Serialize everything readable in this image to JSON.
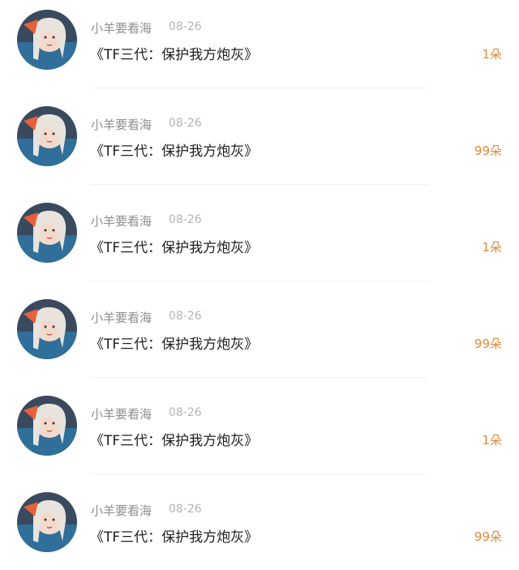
{
  "items": [
    {
      "user": "小羊要看海",
      "date": "08-26",
      "title": "《TF三代：保护我方炮灰》",
      "gift": "1朵"
    },
    {
      "user": "小羊要看海",
      "date": "08-26",
      "title": "《TF三代：保护我方炮灰》",
      "gift": "99朵"
    },
    {
      "user": "小羊要看海",
      "date": "08-26",
      "title": "《TF三代：保护我方炮灰》",
      "gift": "1朵"
    },
    {
      "user": "小羊要看海",
      "date": "08-26",
      "title": "《TF三代：保护我方炮灰》",
      "gift": "99朵"
    },
    {
      "user": "小羊要看海",
      "date": "08-26",
      "title": "《TF三代：保护我方炮灰》",
      "gift": "1朵"
    },
    {
      "user": "小羊要看海",
      "date": "08-26",
      "title": "《TF三代：保护我方炮灰》",
      "gift": "99朵"
    }
  ],
  "colors": {
    "username": "#8e8e8e",
    "date": "#b4b4b4",
    "title": "#1e1e1e",
    "gift": "#e08a3c"
  },
  "avatar_icon": "user-avatar-photo"
}
